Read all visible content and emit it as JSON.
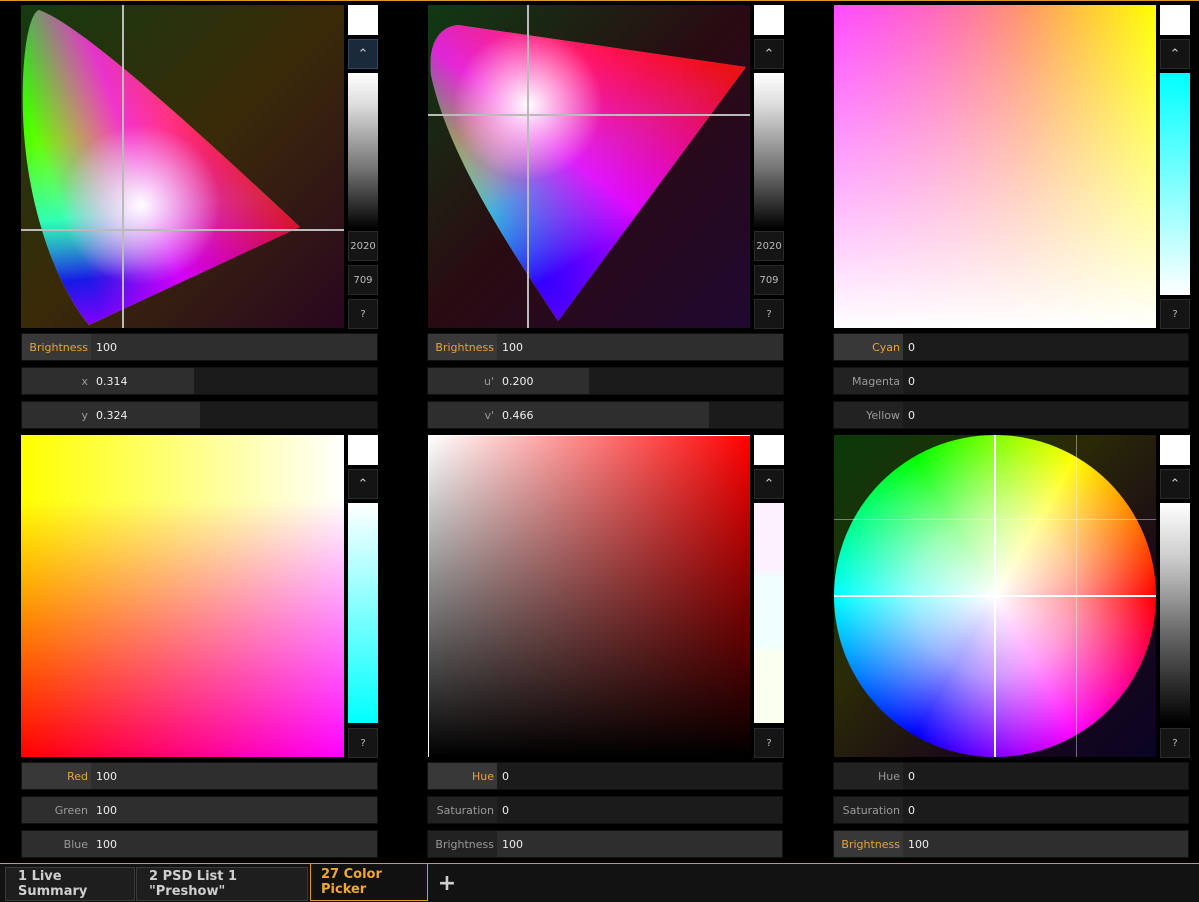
{
  "panels": {
    "xy": {
      "side_buttons": [
        "2020",
        "709",
        "?"
      ],
      "fields": [
        {
          "label": "Brightness",
          "value": "100",
          "highlight": true,
          "fill": 1.0
        },
        {
          "label": "x",
          "value": "0.314",
          "fill": 0.36
        },
        {
          "label": "y",
          "value": "0.324",
          "fill": 0.38
        }
      ]
    },
    "uv": {
      "side_buttons": [
        "2020",
        "709",
        "?"
      ],
      "fields": [
        {
          "label": "Brightness",
          "value": "100",
          "highlight": true,
          "fill": 1.0
        },
        {
          "label": "u'",
          "value": "0.200",
          "fill": 0.32
        },
        {
          "label": "v'",
          "value": "0.466",
          "fill": 0.74
        }
      ]
    },
    "cmy": {
      "side_buttons": [
        "?"
      ],
      "fields": [
        {
          "label": "Cyan",
          "value": "0",
          "highlight": true
        },
        {
          "label": "Magenta",
          "value": "0"
        },
        {
          "label": "Yellow",
          "value": "0"
        }
      ]
    },
    "rgb": {
      "side_buttons": [
        "?"
      ],
      "fields": [
        {
          "label": "Red",
          "value": "100",
          "highlight": true
        },
        {
          "label": "Green",
          "value": "100"
        },
        {
          "label": "Blue",
          "value": "100"
        }
      ]
    },
    "hsb_square": {
      "side_buttons": [
        "?"
      ],
      "fields": [
        {
          "label": "Hue",
          "value": "0",
          "highlight": true
        },
        {
          "label": "Saturation",
          "value": "0"
        },
        {
          "label": "Brightness",
          "value": "100"
        }
      ]
    },
    "hsb_wheel": {
      "side_buttons": [
        "?"
      ],
      "fields": [
        {
          "label": "Hue",
          "value": "0"
        },
        {
          "label": "Saturation",
          "value": "0"
        },
        {
          "label": "Brightness",
          "value": "100",
          "highlight": true
        }
      ]
    }
  },
  "tabs": [
    {
      "label": "1 Live Summary",
      "active": false
    },
    {
      "label": "2 PSD List 1 \"Preshow\"",
      "active": false
    },
    {
      "label": "27 Color Picker",
      "active": true
    }
  ],
  "add_tab_label": "+",
  "up_icon": "chevron-up-icon",
  "colors": {
    "accent": "#f0a830",
    "tab_border": "#d99a2b",
    "background": "#000000"
  }
}
